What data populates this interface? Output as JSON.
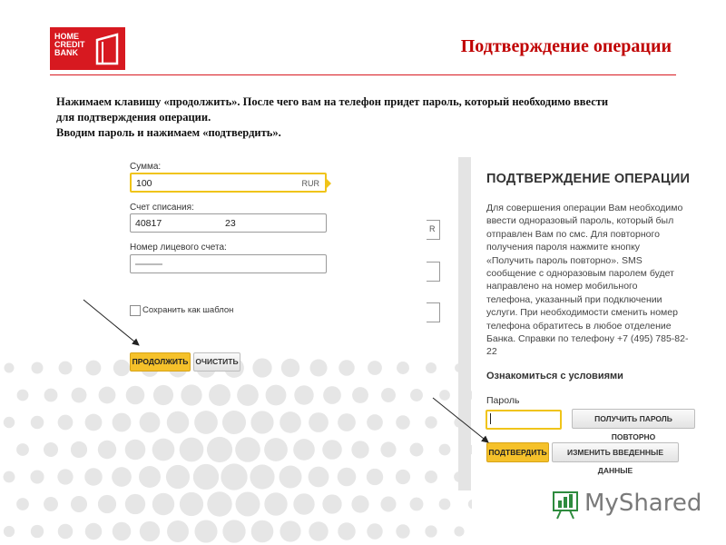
{
  "header": {
    "logo": {
      "lines": [
        "HOME",
        "CREDIT",
        "BANK"
      ],
      "color": "#d71920"
    },
    "slide_title": "Подтверждение операции"
  },
  "instructions": [
    "Нажимаем клавишу «продолжить». После чего вам на телефон придет пароль, который необходимо ввести",
    "для подтверждения операции.",
    "Вводим пароль и нажимаем «подтвердить»."
  ],
  "left_form": {
    "sum": {
      "label": "Сумма:",
      "value": "100",
      "currency": "RUR"
    },
    "account": {
      "label": "Счет списания:",
      "value": "40817",
      "value_tail": "23"
    },
    "personal_account": {
      "label": "Номер лицевого счета:"
    },
    "side_fragment": "R",
    "save_template": {
      "label": "Сохранить как шаблон",
      "checked": false
    },
    "continue_button": "ПРОДОЛЖИТЬ",
    "clear_button": "ОЧИСТИТЬ"
  },
  "right_panel": {
    "title": "ПОДТВЕРЖДЕНИЕ ОПЕРАЦИИ",
    "text_lines": [
      "Для совершения операции Вам необходимо",
      "ввести одноразовый пароль, который был",
      "отправлен Вам по смс. Для повторного",
      "получения пароля нажмите кнопку",
      "«Получить пароль повторно». SMS",
      "сообщение с одноразовым паролем будет",
      "направлено на номер мобильного",
      "телефона, указанный при подключении",
      "услуги. При необходимости сменить номер",
      "телефона обратитесь в любое отделение",
      "Банка. Справки по телефону +7 (495) 785-82-",
      "22"
    ],
    "terms_link": "Ознакомиться с условиями",
    "password_label": "Пароль",
    "password_value": "",
    "resend_button": "ПОЛУЧИТЬ ПАРОЛЬ ПОВТОРНО",
    "confirm_button": "ПОДТВЕРДИТЬ",
    "change_button": "ИЗМЕНИТЬ ВВЕДЕННЫЕ ДАННЫЕ"
  },
  "watermark": {
    "text": "MyShared",
    "icon": "myshared-logo-icon"
  },
  "colors": {
    "brand_red": "#d71920",
    "title_red": "#c00000",
    "button_yellow": "#f5c12a",
    "highlight_border": "#f0c419"
  }
}
